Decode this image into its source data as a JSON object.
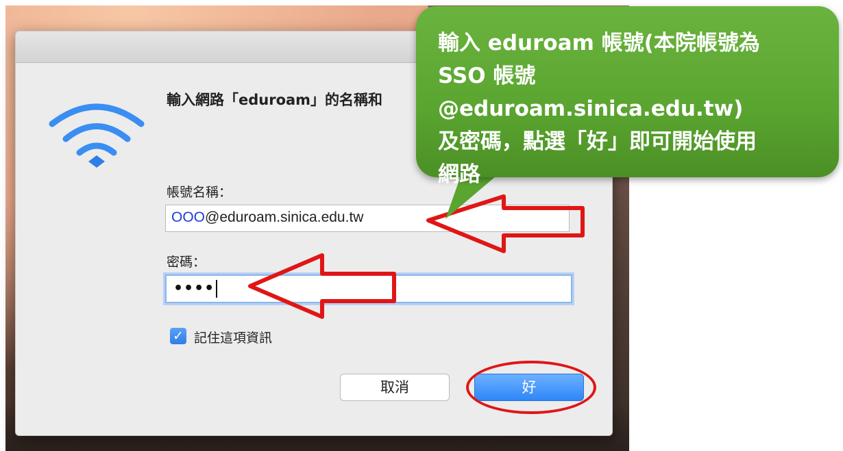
{
  "dialog": {
    "prompt": "輸入網路「eduroam」的名稱和",
    "username_label": "帳號名稱：",
    "username_prefix": "OOO",
    "username_suffix": "@eduroam.sinica.edu.tw",
    "password_label": "密碼：",
    "password_mask": "••••",
    "remember_label": "記住這項資訊",
    "remember_checked": true,
    "cancel_label": "取消",
    "ok_label": "好"
  },
  "callout": {
    "lines": [
      "輸入 eduroam 帳號(本院帳號為",
      "SSO 帳號@eduroam.sinica.edu.tw)",
      "及密碼，點選「好」即可開始使用",
      "網路"
    ]
  },
  "icons": {
    "wifi": "wifi-icon",
    "checkbox": "checkmark-icon"
  },
  "colors": {
    "accent": "#2f86f7",
    "callout": "#5aa530",
    "annotation": "#e01616"
  }
}
